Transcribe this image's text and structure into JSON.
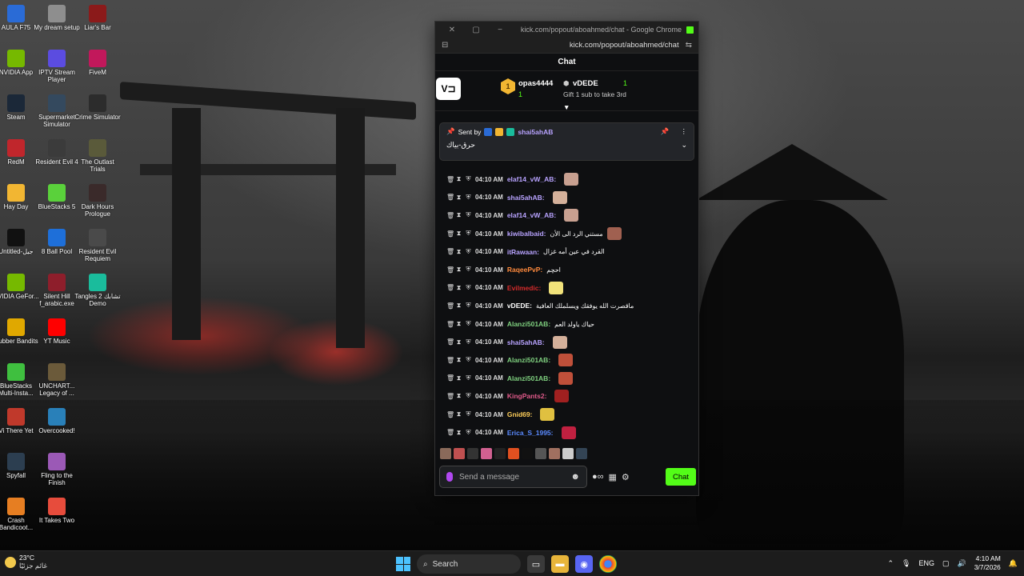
{
  "desktop": {
    "col1": [
      {
        "label": "AULA F75",
        "icon": "aula-icon",
        "color": "#2a6bd6"
      },
      {
        "label": "NVIDIA App",
        "icon": "nvidia-icon",
        "color": "#76b900"
      },
      {
        "label": "Steam",
        "icon": "steam-icon",
        "color": "#1b2838"
      },
      {
        "label": "RedM",
        "icon": "redm-icon",
        "color": "#c0262c"
      },
      {
        "label": "Hay Day",
        "icon": "hayday-icon",
        "color": "#f2b632"
      },
      {
        "label": "Untitled-جيل",
        "icon": "untitled-icon",
        "color": "#111111"
      },
      {
        "label": "NVIDIA GeFor...",
        "icon": "geforce-icon",
        "color": "#76b900"
      },
      {
        "label": "Rubber Bandits",
        "icon": "rubber-bandits-icon",
        "color": "#e0a800"
      },
      {
        "label": "BlueStacks Multi-Insta...",
        "icon": "bluestacks-multi-icon",
        "color": "#3fbf3f"
      },
      {
        "label": "Vi There Yet",
        "icon": "vi-there-yet-icon",
        "color": "#c0392b"
      },
      {
        "label": "Spyfall",
        "icon": "spyfall-icon",
        "color": "#2c3e50"
      },
      {
        "label": "Crash Bandicoot...",
        "icon": "crash-icon",
        "color": "#e67e22"
      }
    ],
    "col2": [
      {
        "label": "My dream setup",
        "icon": "mydream-icon",
        "color": "#8e8e8e"
      },
      {
        "label": "IPTV Stream Player",
        "icon": "iptv-icon",
        "color": "#5b4ce0"
      },
      {
        "label": "Supermarket Simulator",
        "icon": "supermarket-icon",
        "color": "#34495e"
      },
      {
        "label": "Resident Evil 4",
        "icon": "re4-icon",
        "color": "#3b3b3b"
      },
      {
        "label": "BlueStacks 5",
        "icon": "bluestacks-icon",
        "color": "#5ad13b"
      },
      {
        "label": "8 Ball Pool",
        "icon": "8ball-icon",
        "color": "#1e6fd9"
      },
      {
        "label": "Silent Hill f_arabic.exe",
        "icon": "silenthill-icon",
        "color": "#8e1e2b"
      },
      {
        "label": "YT Music",
        "icon": "ytmusic-icon",
        "color": "#ff0000"
      },
      {
        "label": "UNCHART... Legacy of ...",
        "icon": "uncharted-icon",
        "color": "#6b5a3a"
      },
      {
        "label": "Overcooked!",
        "icon": "overcooked-icon",
        "color": "#2980b9"
      },
      {
        "label": "Fling to the Finish",
        "icon": "fling-icon",
        "color": "#9b59b6"
      },
      {
        "label": "It Takes Two",
        "icon": "ittakestwo-icon",
        "color": "#e74c3c"
      }
    ],
    "col3": [
      {
        "label": "Liar's Bar",
        "icon": "liarsbar-icon",
        "color": "#8b1a1a"
      },
      {
        "label": "FiveM",
        "icon": "fivem-icon",
        "color": "#c2185b"
      },
      {
        "label": "Crime Simulator",
        "icon": "crime-icon",
        "color": "#2c2c2c"
      },
      {
        "label": "The Outlast Trials",
        "icon": "outlast-icon",
        "color": "#5a5a3a"
      },
      {
        "label": "Dark Hours Prologue",
        "icon": "darkhours-icon",
        "color": "#3a2a2a"
      },
      {
        "label": "Resident Evil Requiem",
        "icon": "re-requiem-icon",
        "color": "#4a4a4a"
      },
      {
        "label": "Tangles 2 تشابك Demo",
        "icon": "tangles-icon",
        "color": "#1abc9c"
      }
    ]
  },
  "window": {
    "title": "kick.com/popout/aboahmed/chat - Google Chrome",
    "url": "kick.com/popout/aboahmed/chat",
    "header": "Chat"
  },
  "leaderboard": {
    "first_rank": "1",
    "first_name": "opas4444",
    "first_count": "1",
    "second_name": "vDEDE",
    "second_count": "1",
    "second_sub": "Gift 1 sub to take 3rd"
  },
  "pinned": {
    "sent_by": "Sent by",
    "user": "shai5ahAB",
    "text": "حرق-بياك"
  },
  "messages": [
    {
      "time": "04:10 AM",
      "user": "elaf14_vW_AB:",
      "user_color": "#b8a3ff",
      "text": "",
      "emote_color": "#c8a090"
    },
    {
      "time": "04:10 AM",
      "user": "shai5ahAB:",
      "user_color": "#b8a3ff",
      "text": "",
      "emote_color": "#d4b09a"
    },
    {
      "time": "04:10 AM",
      "user": "elaf14_vW_AB:",
      "user_color": "#b8a3ff",
      "text": "",
      "emote_color": "#c8a090"
    },
    {
      "time": "04:10 AM",
      "user": "kiwibalbaid:",
      "user_color": "#b8a3ff",
      "text": "مستني الرد الى الأن",
      "emote_color": "#a06050"
    },
    {
      "time": "04:10 AM",
      "user": "itRawaan:",
      "user_color": "#b8a3ff",
      "text": "القرد في عين أمه غزال",
      "emote_color": ""
    },
    {
      "time": "04:10 AM",
      "user": "RaqeePvP:",
      "user_color": "#ff8a3d",
      "text": "احچم",
      "emote_color": ""
    },
    {
      "time": "04:10 AM",
      "user": "Evilmedic:",
      "user_color": "#d62b2b",
      "text": "",
      "emote_color": "#f1e27a"
    },
    {
      "time": "04:10 AM",
      "user": "vDEDE:",
      "user_color": "#ffffff",
      "text": "ماقصرت الله يوفقك ويسلملك العافية",
      "emote_color": ""
    },
    {
      "time": "04:10 AM",
      "user": "Alanzi501AB:",
      "user_color": "#7fd07f",
      "text": "حياك ياولد العم",
      "emote_color": ""
    },
    {
      "time": "04:10 AM",
      "user": "shai5ahAB:",
      "user_color": "#b8a3ff",
      "text": "",
      "emote_color": "#d4b09a"
    },
    {
      "time": "04:10 AM",
      "user": "Alanzi501AB:",
      "user_color": "#7fd07f",
      "text": "",
      "emote_color": "#c0503a"
    },
    {
      "time": "04:10 AM",
      "user": "Alanzi501AB:",
      "user_color": "#7fd07f",
      "text": "",
      "emote_color": "#c0503a"
    },
    {
      "time": "04:10 AM",
      "user": "KingPants2:",
      "user_color": "#e05a8a",
      "text": "",
      "emote_color": "#a02020"
    },
    {
      "time": "04:10 AM",
      "user": "Gnid69:",
      "user_color": "#ffcf5a",
      "text": "",
      "emote_color": "#e0c040"
    },
    {
      "time": "04:10 AM",
      "user": "Erica_S_1995:",
      "user_color": "#5a8aff",
      "text": "",
      "emote_color": "#c02040"
    }
  ],
  "input": {
    "placeholder": "Send a message",
    "chat_button": "Chat"
  },
  "taskbar": {
    "temp": "23°C",
    "weather_desc": "غائم جزئيًا",
    "search": "Search",
    "lang": "ENG",
    "time": "4:10 AM",
    "date": "3/7/2026"
  },
  "colors": {
    "kick_green": "#53fc18",
    "chat_bg": "#0e0f11"
  }
}
